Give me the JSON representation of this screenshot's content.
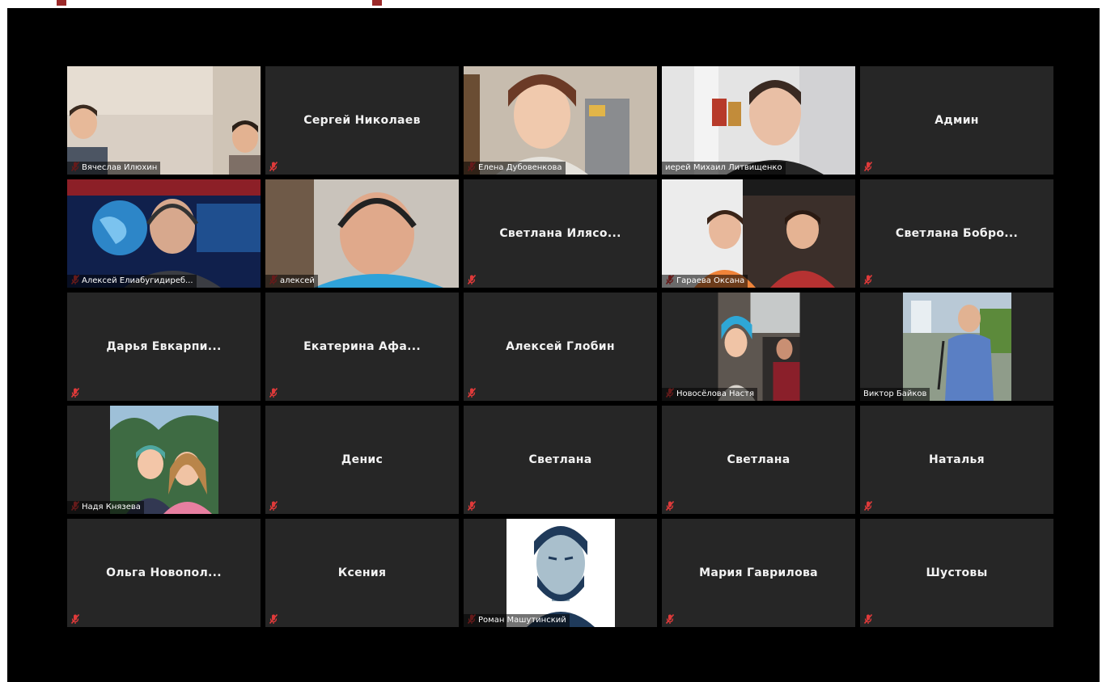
{
  "accent": {
    "active_speaker_border": "#c6e35b",
    "muted_icon": "#e03a3a",
    "tile_bg": "#262626"
  },
  "tiles": [
    {
      "text": "Вячеслав Илюхин",
      "video": true
    },
    {
      "text": "Сергей Николаев",
      "video": false
    },
    {
      "text": "Елена Дубовенкова",
      "video": true
    },
    {
      "text": "иерей Михаил Литвищенко",
      "video": true,
      "active": true
    },
    {
      "text": "Админ",
      "video": false
    },
    {
      "text": "Алексей Елиабугидиреб...",
      "video": true
    },
    {
      "text": "алексей",
      "video": true
    },
    {
      "text": "Светлана Илясо...",
      "video": false
    },
    {
      "text": "Гараева Оксана",
      "video": true
    },
    {
      "text": "Светлана Бобро...",
      "video": false
    },
    {
      "text": "Дарья Евкарпи...",
      "video": false
    },
    {
      "text": "Екатерина Афа...",
      "video": false
    },
    {
      "text": "Алексей Глобин",
      "video": false
    },
    {
      "text": "Новосёлова Настя",
      "video": true
    },
    {
      "text": "Виктор Байков",
      "video": true
    },
    {
      "text": "Надя Князева",
      "video": true
    },
    {
      "text": "Денис",
      "video": false
    },
    {
      "text": "Светлана",
      "video": false
    },
    {
      "text": "Светлана",
      "video": false
    },
    {
      "text": "Наталья",
      "video": false
    },
    {
      "text": "Ольга Новопол...",
      "video": false
    },
    {
      "text": "Ксения",
      "video": false
    },
    {
      "text": "Роман Машутинский",
      "video": true
    },
    {
      "text": "Мария Гаврилова",
      "video": false
    },
    {
      "text": "Шустовы",
      "video": false
    }
  ]
}
